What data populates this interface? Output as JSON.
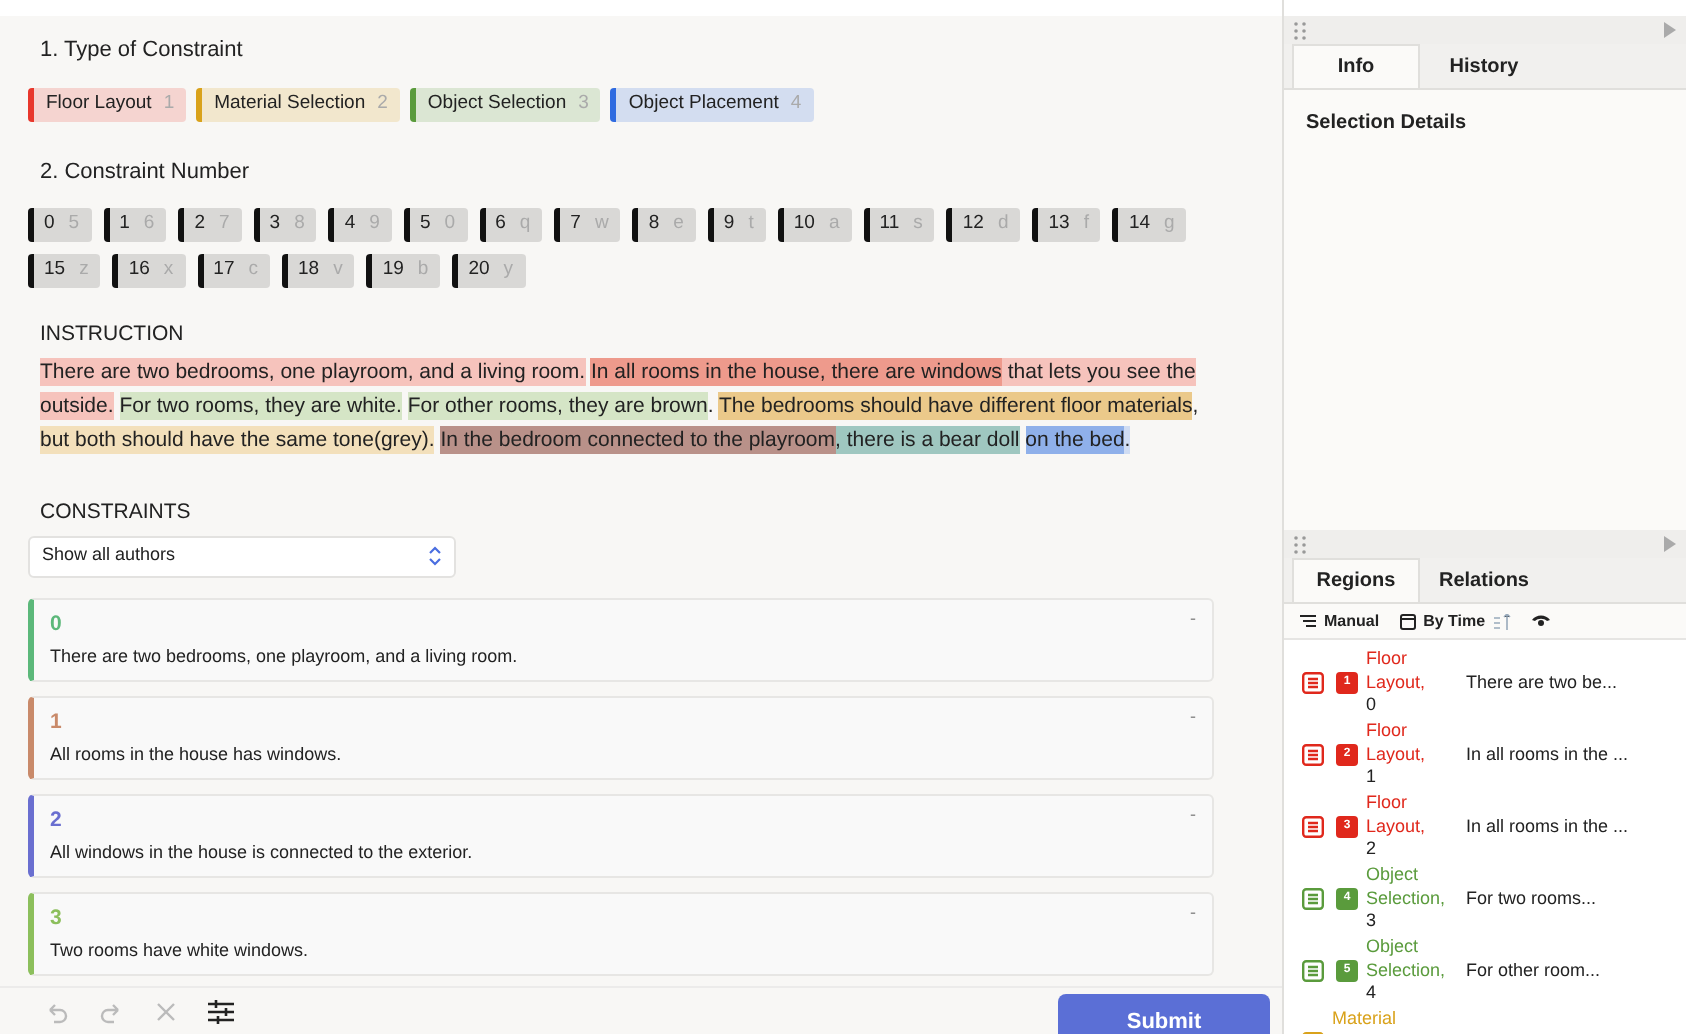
{
  "type_section": {
    "heading": "1. Type of Constraint",
    "types": [
      {
        "label": "Floor Layout",
        "key": "1",
        "color": "#e8372c"
      },
      {
        "label": "Material Selection",
        "key": "2",
        "color": "#d9a21b"
      },
      {
        "label": "Object Selection",
        "key": "3",
        "color": "#5a9b3c"
      },
      {
        "label": "Object Placement",
        "key": "4",
        "color": "#2f6be0"
      }
    ]
  },
  "number_section": {
    "heading": "2. Constraint Number",
    "numbers": [
      {
        "label": "0",
        "key": "5"
      },
      {
        "label": "1",
        "key": "6"
      },
      {
        "label": "2",
        "key": "7"
      },
      {
        "label": "3",
        "key": "8"
      },
      {
        "label": "4",
        "key": "9"
      },
      {
        "label": "5",
        "key": "0"
      },
      {
        "label": "6",
        "key": "q"
      },
      {
        "label": "7",
        "key": "w"
      },
      {
        "label": "8",
        "key": "e"
      },
      {
        "label": "9",
        "key": "t"
      },
      {
        "label": "10",
        "key": "a"
      },
      {
        "label": "11",
        "key": "s"
      },
      {
        "label": "12",
        "key": "d"
      },
      {
        "label": "13",
        "key": "f"
      },
      {
        "label": "14",
        "key": "g"
      },
      {
        "label": "15",
        "key": "z"
      },
      {
        "label": "16",
        "key": "x"
      },
      {
        "label": "17",
        "key": "c"
      },
      {
        "label": "18",
        "key": "v"
      },
      {
        "label": "19",
        "key": "b"
      },
      {
        "label": "20",
        "key": "y"
      }
    ]
  },
  "instruction": {
    "heading": "INSTRUCTION",
    "segments": [
      {
        "text": "There are two bedrooms, one playroom, and a living room.",
        "color": "#f6c3bc",
        "space_after": true
      },
      {
        "text": "In all rooms in the house, there are windows",
        "color": "#ee9a8c"
      },
      {
        "text": " that lets you see the outside.",
        "color": "#f6c3bc",
        "space_after": true
      },
      {
        "text": "For two rooms, they are white.",
        "color": "#d5e5c6",
        "space_after": true
      },
      {
        "text": "For other rooms, they are brown",
        "color": "#d5e5c6"
      },
      {
        "text": ".",
        "space_after": true
      },
      {
        "text": "The bedrooms should have different floor materials",
        "color": "#ebc98a"
      },
      {
        "text": ",",
        "space_after": true
      },
      {
        "text": "but both should have the same tone(grey).",
        "color": "#f3e0bb",
        "space_after": true
      },
      {
        "text": "In the bedroom connected to the playroom",
        "color": "#b99189"
      },
      {
        "text": ", there is a bear doll",
        "color": "#9fc7c0",
        "space_after": true
      },
      {
        "text": "on the bed",
        "color": "#8fb0ea"
      },
      {
        "text": ".",
        "color": "#cfdcf3"
      }
    ]
  },
  "constraints": {
    "heading": "CONSTRAINTS",
    "author_filter": "Show all authors",
    "items": [
      {
        "number": "0",
        "text": "There are two bedrooms, one playroom, and a living room.",
        "color": "#5cb87a",
        "menu": "-"
      },
      {
        "number": "1",
        "text": "All rooms in the house has windows.",
        "color": "#c98a6a",
        "menu": "-"
      },
      {
        "number": "2",
        "text": "All windows in the house is connected to the exterior.",
        "color": "#6a6fd0",
        "menu": "-"
      },
      {
        "number": "3",
        "text": "Two rooms have white windows.",
        "color": "#8cbf5c",
        "menu": "-"
      }
    ]
  },
  "toolbar": {
    "submit": "Submit"
  },
  "info_panel": {
    "tabs": [
      {
        "label": "Info",
        "selected": true
      },
      {
        "label": "History",
        "selected": false
      }
    ],
    "heading": "Selection Details"
  },
  "regions_panel": {
    "tabs": [
      {
        "label": "Regions",
        "selected": true
      },
      {
        "label": "Relations",
        "selected": false
      }
    ],
    "sort_manual": "Manual",
    "sort_time": "By Time",
    "items": [
      {
        "badge": "1",
        "category": "Floor Layout,",
        "text": "There are two be...",
        "index": "0",
        "color": "#e0281c"
      },
      {
        "badge": "2",
        "category": "Floor Layout,",
        "text": "In all rooms in the ...",
        "index": "1",
        "color": "#e0281c"
      },
      {
        "badge": "3",
        "category": "Floor Layout,",
        "text": "In all rooms in the ...",
        "index": "2",
        "color": "#e0281c"
      },
      {
        "badge": "4",
        "category": "Object Selection,",
        "text": "For two rooms...",
        "index": "3",
        "color": "#5a9b3c"
      },
      {
        "badge": "5",
        "category": "Object Selection,",
        "text": "For other room...",
        "index": "4",
        "color": "#5a9b3c"
      },
      {
        "category": "Material",
        "color": "#d9a21b"
      }
    ]
  }
}
